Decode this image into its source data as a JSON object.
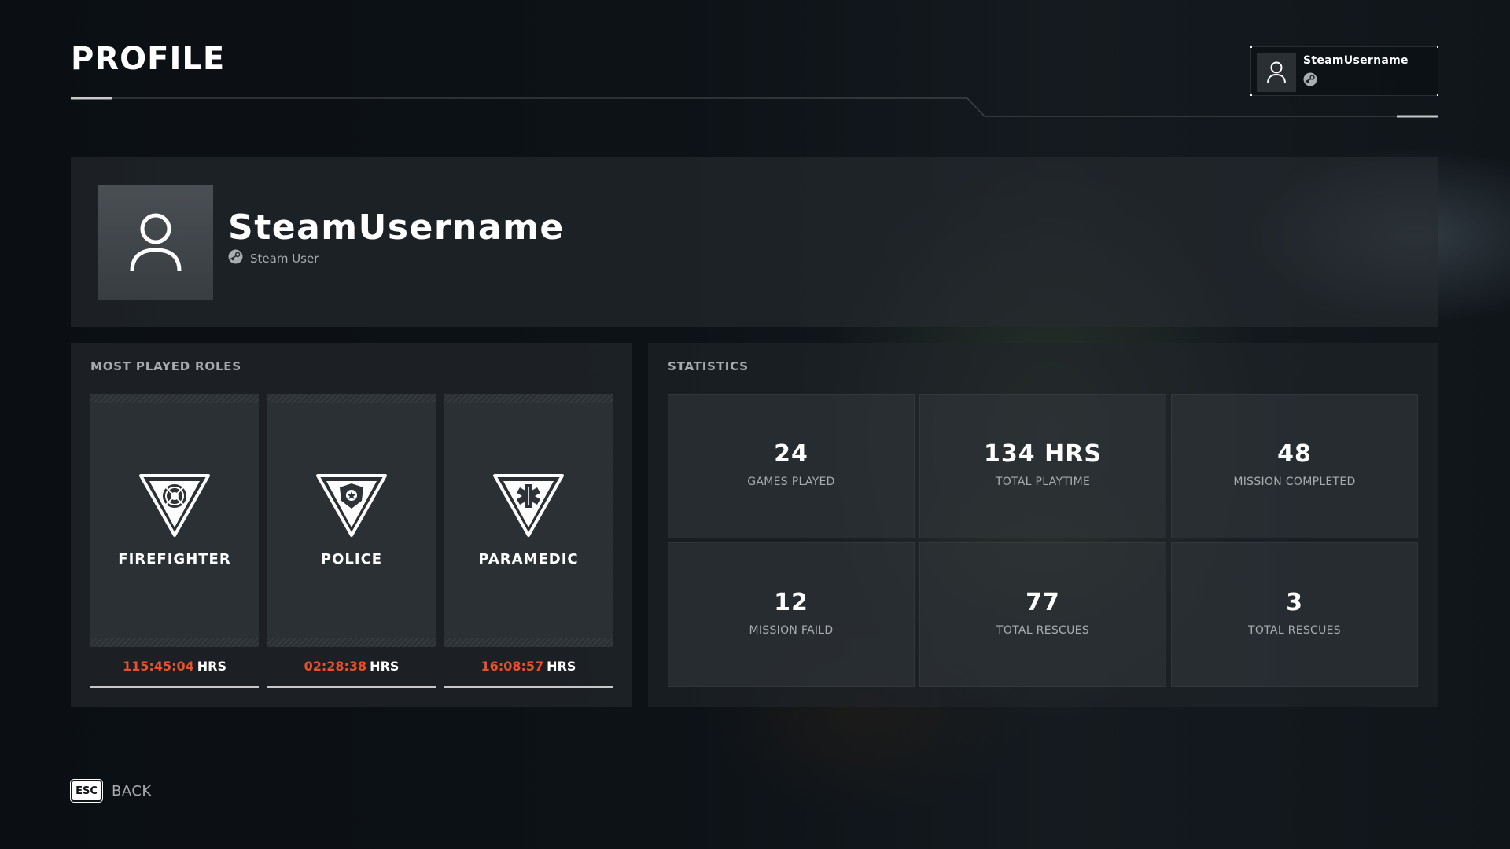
{
  "header": {
    "title": "PROFILE",
    "user_chip": {
      "username": "SteamUsername"
    }
  },
  "profile": {
    "username": "SteamUsername",
    "platform_label": "Steam User"
  },
  "roles": {
    "section_label": "MOST PLAYED ROLES",
    "items": [
      {
        "name": "FIREFIGHTER",
        "time": "115:45:04",
        "unit": "HRS",
        "icon": "firefighter-badge-icon"
      },
      {
        "name": "POLICE",
        "time": "02:28:38",
        "unit": "HRS",
        "icon": "police-badge-icon"
      },
      {
        "name": "PARAMEDIC",
        "time": "16:08:57",
        "unit": "HRS",
        "icon": "paramedic-star-of-life-icon"
      }
    ]
  },
  "statistics": {
    "section_label": "STATISTICS",
    "items": [
      {
        "value": "24",
        "label": "GAMES PLAYED"
      },
      {
        "value": "134 HRS",
        "label": "TOTAL PLAYTIME"
      },
      {
        "value": "48",
        "label": "MISSION COMPLETED"
      },
      {
        "value": "12",
        "label": "MISSION FAILD"
      },
      {
        "value": "77",
        "label": "TOTAL RESCUES"
      },
      {
        "value": "3",
        "label": "TOTAL RESCUES"
      }
    ]
  },
  "footer": {
    "back_key": "ESC",
    "back_label": "BACK"
  },
  "colors": {
    "accent_orange": "#e8512b",
    "panel": "#262b30",
    "background": "#0b0f13"
  }
}
